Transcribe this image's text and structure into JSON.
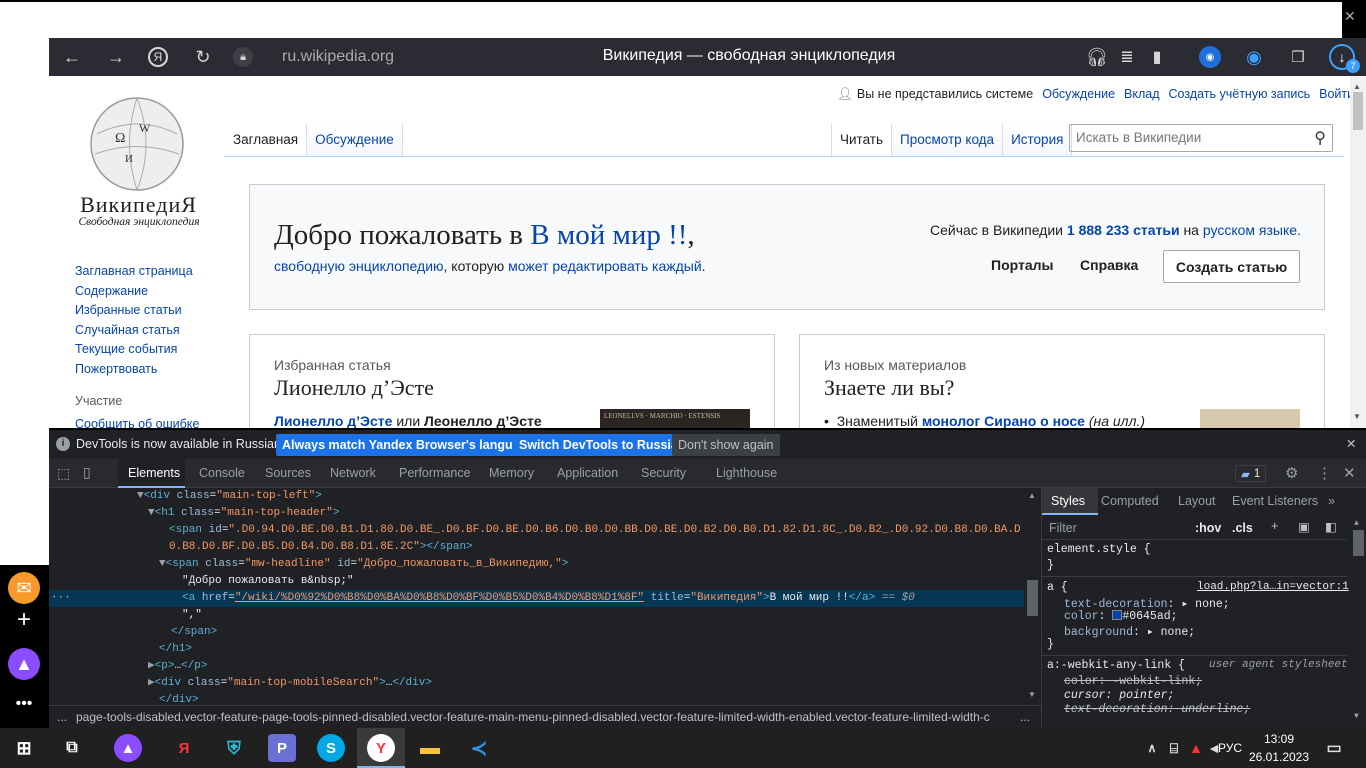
{
  "browser": {
    "url": "ru.wikipedia.org",
    "page_title": "Википедия — свободная энциклопедия",
    "download_count": "7"
  },
  "wiki": {
    "logo_name": "ВикипедиЯ",
    "logo_sub": "Свободная энциклопедия",
    "nav": [
      "Заглавная страница",
      "Содержание",
      "Избранные статьи",
      "Случайная статья",
      "Текущие события",
      "Пожертвовать"
    ],
    "section_head": "Участие",
    "section_item": "Сообщить об ошибке",
    "personal": {
      "not_logged": "Вы не представились системе",
      "talk": "Обсуждение",
      "contrib": "Вклад",
      "create_account": "Создать учётную запись",
      "login": "Войти"
    },
    "tabs_left": [
      "Заглавная",
      "Обсуждение"
    ],
    "tabs_right": [
      "Читать",
      "Просмотр кода",
      "История"
    ],
    "search_placeholder": "Искать в Википедии",
    "welcome_prefix": "Добро пожаловать в ",
    "welcome_link": "В мой мир !!",
    "welcome_suffix": ",",
    "welcome_line2_a": "свободную энциклопедию",
    "welcome_line2_b": ", которую ",
    "welcome_line2_c": "может редактировать каждый",
    "welcome_line2_d": ".",
    "count_a": "Сейчас в Википедии ",
    "count_num": "1 888 233 статьи",
    "count_b": " на ",
    "count_lang": "русском языке.",
    "portals": "Порталы",
    "help": "Справка",
    "create_article": "Создать статью",
    "featured_head": "Избранная статья",
    "featured_title": "Лионелло д’Эсте",
    "featured_text_a": "Лионелло д’Эсте",
    "featured_text_b": " или ",
    "featured_text_c": "Леонелло д’Эсте",
    "new_head": "Из новых материалов",
    "new_title": "Знаете ли вы?",
    "new_text_a": "Знаменитый ",
    "new_text_b": "монолог Сирано о носе",
    "new_text_c": " (на илл.)",
    "img_caption": "LEONELLVS · MARCHIO · ESTENSIS"
  },
  "devtools": {
    "info_text": "DevTools is now available in Russian!",
    "btn_match": "Always match Yandex Browser's language",
    "btn_switch": "Switch DevTools to Russian",
    "btn_dont": "Don't show again",
    "tabs": [
      "Elements",
      "Console",
      "Sources",
      "Network",
      "Performance",
      "Memory",
      "Application",
      "Security",
      "Lighthouse"
    ],
    "issues_count": "1",
    "dom": {
      "l1_tag": "<div ",
      "l1_attr": "class",
      "l1_val": "\"main-top-left\"",
      "l1_end": ">",
      "l2_tag": "<h1 ",
      "l2_attr": "class",
      "l2_val": "\"main-top-header\"",
      "l2_end": ">",
      "l3_tag": "<span ",
      "l3_attr": "id",
      "l3_val": "\".D0.94.D0.BE.D0.B1.D1.80.D0.BE_.D0.BF.D0.BE.D0.B6.D0.B0.D0.BB.D0.BE.D0.B2.D0.B0.D1.82.D1.8C_.D0.B2_.D0.92.D0.B8.D0.BA.D",
      "l3b_val": "0.B8.D0.BF.D0.B5.D0.B4.D0.B8.D1.8E.2C\"",
      "l3b_end": "></span>",
      "l4_tag": "<span ",
      "l4_attr1": "class",
      "l4_val1": "\"mw-headline\"",
      "l4_attr2": "id",
      "l4_val2": "\"Добро_пожаловать_в_Википедию,\"",
      "l4_end": ">",
      "l5_text": "\"Добро пожаловать в&nbsp;\"",
      "l6_tag": "<a ",
      "l6_attr1": "href",
      "l6_val1": "\"/wiki/%D0%92%D0%B8%D0%BA%D0%B8%D0%BF%D0%B5%D0%B4%D0%B8%D1%8F\"",
      "l6_attr2": "title",
      "l6_val2": "\"Википедия\"",
      "l6_text": "В мой мир !!",
      "l6_close": "</a>",
      "l6_sel": "== $0",
      "l7_text": "\",\"",
      "l8_tag": "</span>",
      "l9_tag": "</h1>",
      "l10_tag": "<p>",
      "l10_ell": "…",
      "l10_close": "</p>",
      "l11_tag": "<div ",
      "l11_attr": "class",
      "l11_val": "\"main-top-mobileSearch\"",
      "l11_end": ">",
      "l11_ell": "…",
      "l11_close": "</div>",
      "l12_tag": "</div>"
    },
    "breadcrumb": "page-tools-disabled.vector-feature-page-tools-pinned-disabled.vector-feature-main-menu-pinned-disabled.vector-feature-limited-width-enabled.vector-feature-limited-width-c",
    "styles_tabs": [
      "Styles",
      "Computed",
      "Layout",
      "Event Listeners"
    ],
    "filter_placeholder": "Filter",
    "hov": ":hov",
    "cls": ".cls",
    "rule0_sel": "element.style {",
    "rule0_close": "}",
    "rule1_sel": "a {",
    "rule1_src": "load.php?la…in=vector:1",
    "rule1_p1": "text-decoration",
    "rule1_v1": "none;",
    "rule1_p2": "color",
    "rule1_v2": "#0645ad;",
    "rule1_p3": "background",
    "rule1_v3": "none;",
    "rule1_close": "}",
    "rule2_sel": "a:-webkit-any-link {",
    "rule2_src": "user agent stylesheet",
    "rule2_p1": "color: -webkit-link;",
    "rule2_p2": "cursor: pointer;",
    "rule2_p3": "text-decoration: underline;",
    "color_swatch": "#0645ad"
  },
  "taskbar": {
    "lang": "РУС",
    "time": "13:09",
    "date": "26.01.2023"
  }
}
